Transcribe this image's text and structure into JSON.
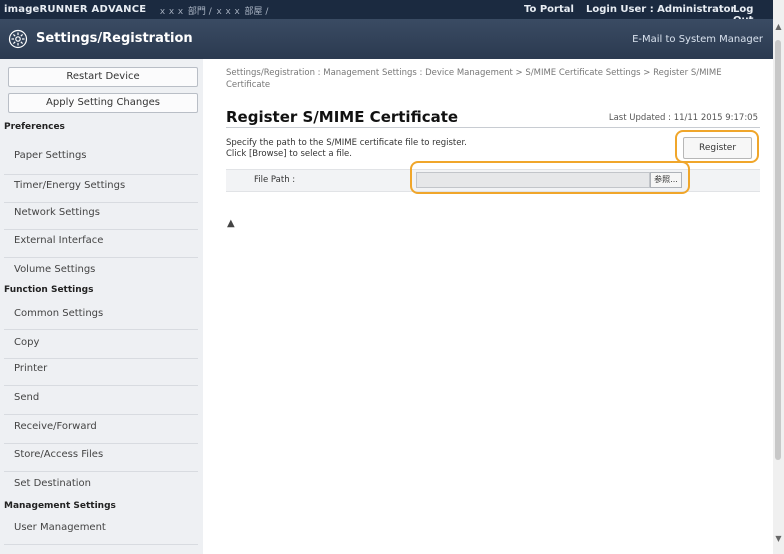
{
  "topbar": {
    "app_name": "imageRUNNER ADVANCE",
    "device_label": "ｘｘｘ 部門 / ｘｘｘ 部屋 /",
    "to_portal": "To Portal",
    "login_user": "Login User : Administrator",
    "logout": "Log Out"
  },
  "header": {
    "title": "Settings/Registration",
    "email_link": "E-Mail to System Manager",
    "icon": "gear-icon"
  },
  "sidebar": {
    "restart_button": "Restart Device",
    "apply_button": "Apply Setting Changes",
    "categories": [
      {
        "label": "Preferences",
        "items": [
          "Paper Settings",
          "Timer/Energy Settings",
          "Network Settings",
          "External Interface",
          "Volume Settings"
        ]
      },
      {
        "label": "Function Settings",
        "items": [
          "Common Settings",
          "Copy",
          "Printer",
          "Send",
          "Receive/Forward",
          "Store/Access Files",
          "Set Destination"
        ]
      },
      {
        "label": "Management Settings",
        "items": [
          "User Management"
        ]
      }
    ]
  },
  "main": {
    "breadcrumb": "Settings/Registration : Management Settings : Device Management > S/MIME Certificate Settings > Register S/MIME Certificate",
    "page_title": "Register S/MIME Certificate",
    "last_updated": "Last Updated : 11/11 2015 9:17:05",
    "register_button": "Register",
    "description_line1": "Specify the path to the S/MIME certificate file to register.",
    "description_line2": "Click [Browse] to select a file.",
    "file_path_label": "File Path :",
    "file_path_value": "",
    "browse_button": "参照...",
    "to_top": "▲"
  },
  "colors": {
    "topbar_bg": "#1b2a40",
    "header_bg": "#2f3f56",
    "highlight": "#f0a62b",
    "sidebar_bg": "#eef0f3"
  }
}
